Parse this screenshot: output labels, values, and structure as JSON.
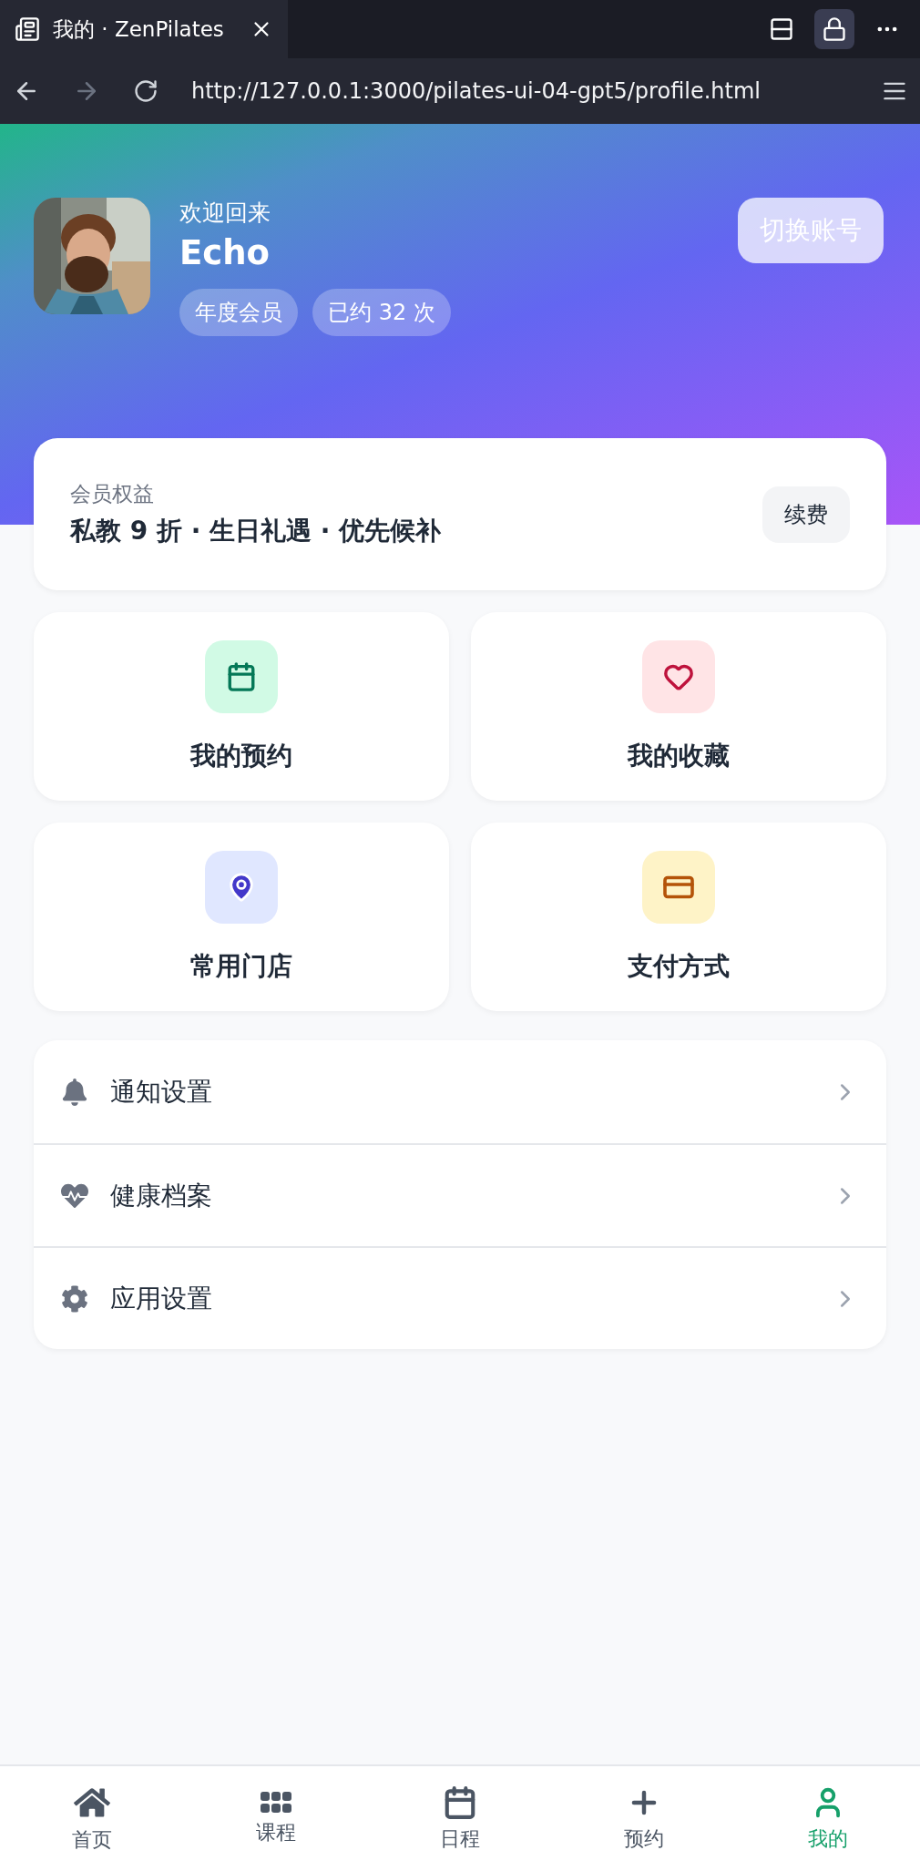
{
  "browser": {
    "tab_title": "我的 · ZenPilates",
    "url": "http://127.0.0.1:3000/pilates-ui-04-gpt5/profile.html"
  },
  "header": {
    "greeting": "欢迎回来",
    "name": "Echo",
    "badges": [
      "年度会员",
      "已约 32 次"
    ],
    "switch_button": "切换账号"
  },
  "benefits": {
    "label": "会员权益",
    "text": "私教 9 折 · 生日礼遇 · 优先候补",
    "button": "续费"
  },
  "shortcuts": [
    {
      "label": "我的预约",
      "kind": "calendar",
      "color": "#047857"
    },
    {
      "label": "我的收藏",
      "kind": "heart",
      "color": "#be123c"
    },
    {
      "label": "常用门店",
      "kind": "pin",
      "color": "#4338ca"
    },
    {
      "label": "支付方式",
      "kind": "card",
      "color": "#b45309"
    }
  ],
  "menu": [
    {
      "label": "通知设置",
      "kind": "bell"
    },
    {
      "label": "健康档案",
      "kind": "health"
    },
    {
      "label": "应用设置",
      "kind": "settings"
    }
  ],
  "nav": [
    {
      "label": "首页",
      "kind": "home",
      "selected": false
    },
    {
      "label": "课程",
      "kind": "grid",
      "selected": false
    },
    {
      "label": "日程",
      "kind": "calendar",
      "selected": false
    },
    {
      "label": "预约",
      "kind": "plus",
      "selected": false
    },
    {
      "label": "我的",
      "kind": "user",
      "selected": true
    }
  ]
}
